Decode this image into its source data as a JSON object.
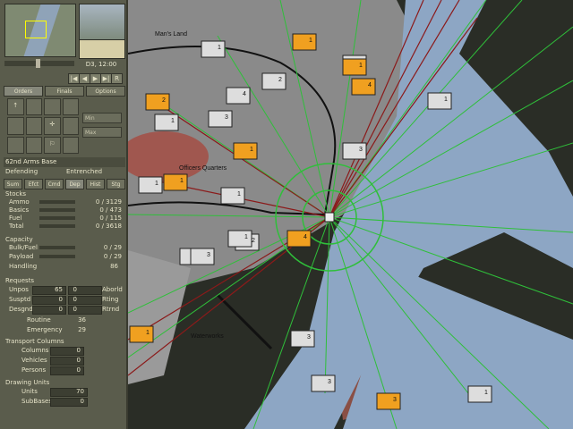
{
  "time": "D3, 12:00",
  "map_labels": {
    "mans_land": "Man's Land",
    "officers_quarters": "Officers Quarters",
    "waterworks": "Waterworks"
  },
  "tabs": [
    "Orders",
    "Finals",
    "Options"
  ],
  "subtabs": [
    "Sum",
    "Efct",
    "Cmd",
    "Dep",
    "Hist",
    "Stg"
  ],
  "playback": [
    "|◀",
    "◀",
    "▶",
    "▶|",
    "⏸",
    "R"
  ],
  "commands": [
    "↑",
    "",
    "",
    "",
    "",
    "",
    "✛",
    "",
    "",
    "",
    "⚐",
    "",
    "",
    "",
    "",
    ""
  ],
  "minmax": [
    "Min",
    "Max"
  ],
  "unit_name": "62nd Arms Base",
  "status_left": "Defending",
  "status_right": "Entrenched",
  "stocks": {
    "title": "Stocks",
    "rows": [
      {
        "label": "Ammo",
        "value": "0 / 3129"
      },
      {
        "label": "Basics",
        "value": "0 / 473"
      },
      {
        "label": "Fuel",
        "value": "0 / 115"
      },
      {
        "label": "Total",
        "value": "0 / 3618"
      }
    ]
  },
  "capacity": {
    "title": "Capacity",
    "rows": [
      {
        "label": "Bulk/Fuel",
        "value": "0 / 29"
      },
      {
        "label": "Payload",
        "value": "0 / 29"
      },
      {
        "label": "Handling",
        "value": "86"
      }
    ]
  },
  "requests": {
    "title": "Requests",
    "pairs": [
      {
        "l": "Unpos",
        "lv": "65",
        "r": "Aborld",
        "rv": "0"
      },
      {
        "l": "Susptd",
        "lv": "0",
        "r": "Rting",
        "rv": "0"
      },
      {
        "l": "Desgnd",
        "lv": "0",
        "r": "Rtrnd",
        "rv": "0"
      }
    ],
    "routine_label": "Routine",
    "routine": "36",
    "emergency_label": "Emergency",
    "emergency": "29"
  },
  "transport": {
    "title": "Transport Columns",
    "rows": [
      {
        "label": "Columns",
        "value": "0"
      },
      {
        "label": "Vehicles",
        "value": "0"
      },
      {
        "label": "Persons",
        "value": "0"
      }
    ]
  },
  "drawing": {
    "title": "Drawing Units",
    "rows": [
      {
        "label": "Units",
        "value": "70"
      },
      {
        "label": "SubBases",
        "value": "0"
      }
    ]
  },
  "counters": [
    "1",
    "3",
    "1",
    "2",
    "4",
    "2",
    "1",
    "1",
    "3",
    "1",
    "1",
    "1",
    "1",
    "2",
    "1",
    "4",
    "3",
    "1",
    "4",
    "3",
    "3",
    "3",
    "1",
    "3",
    "1",
    "1"
  ],
  "colors": {
    "panel": "#5a5c4c",
    "water": "#8da6c4",
    "urban": "#8a8a8a",
    "supply_green": "#2fbf3a",
    "supply_red": "#8b1a1a",
    "counter": "#f0a020"
  }
}
